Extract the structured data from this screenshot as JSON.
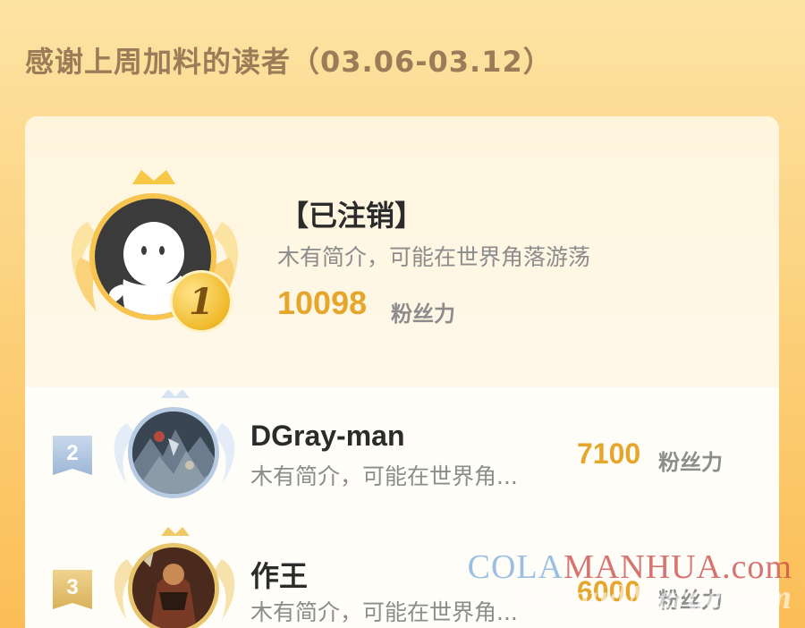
{
  "header": {
    "title": "感谢上周加料的读者（03.06-03.12）"
  },
  "top_reader": {
    "rank": "1",
    "name": "【已注销】",
    "bio": "木有简介，可能在世界角落游荡",
    "score": "10098",
    "unit": "粉丝力"
  },
  "readers": [
    {
      "rank": "2",
      "name": "DGray-man",
      "bio": "木有简介，可能在世界角...",
      "score": "7100",
      "unit": "粉丝力"
    },
    {
      "rank": "3",
      "name": "作王",
      "bio": "木有简介，可能在世界角...",
      "score": "6000",
      "unit": "粉丝力"
    }
  ],
  "watermark": {
    "line1_a": "COLA",
    "line1_b": "MANHUA.com",
    "line2": "ACloudMerge.com"
  },
  "colors": {
    "accent": "#e6a52b",
    "gold": "#f6c44f",
    "silver": "#a9c1dc",
    "bronze": "#e3bf69"
  }
}
